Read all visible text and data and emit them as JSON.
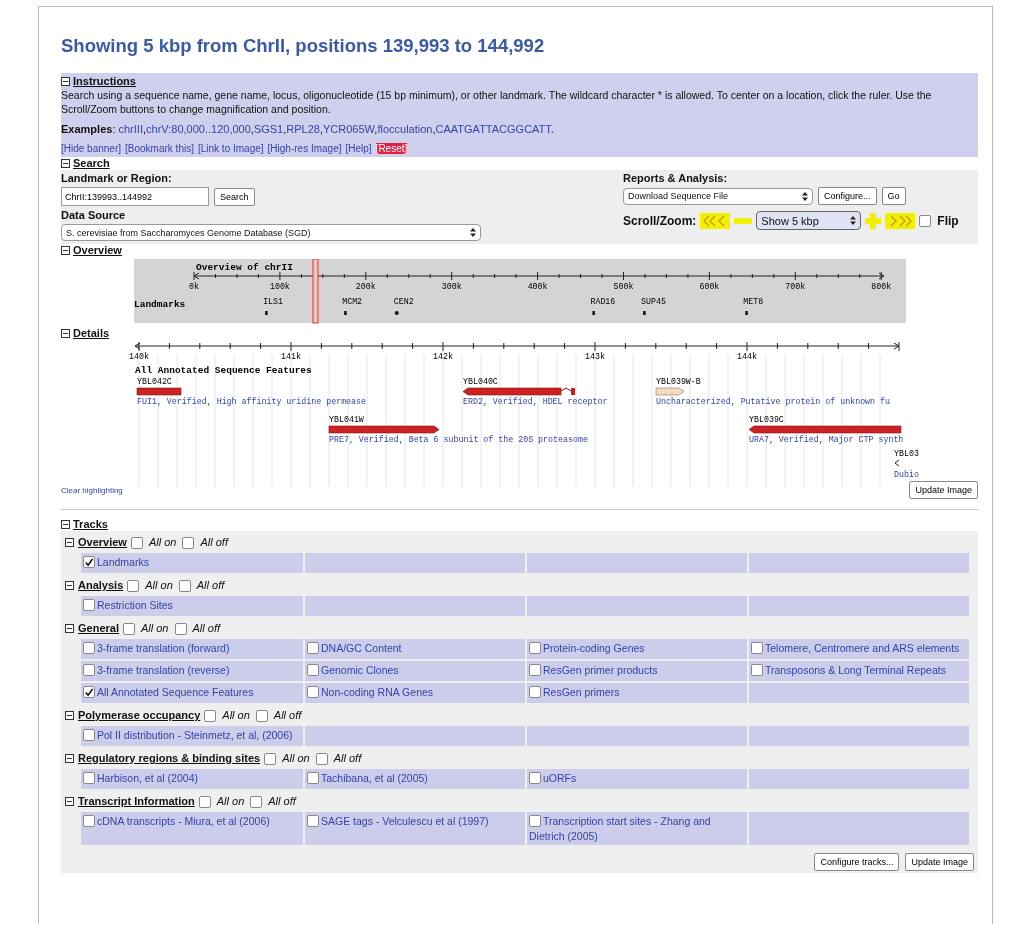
{
  "title": "Showing 5 kbp from ChrII, positions 139,993 to 144,992",
  "instructions": {
    "heading": "Instructions",
    "expanded": true,
    "text": "Search using a sequence name, gene name, locus, oligonucleotide (15 bp minimum), or other landmark. The wildcard character * is allowed. To center on a location, click the ruler. Use the Scroll/Zoom buttons to change magnification and position.",
    "examples_label": "**Examples**:",
    "examples": [
      {
        "label": "chrIII",
        "after": ","
      },
      {
        "label": "chrV:80,000..120,000",
        "after": ","
      },
      {
        "label": "SGS1",
        "after": ","
      },
      {
        "label": "RPL28",
        "after": ","
      },
      {
        "label": "YCR065W",
        "after": ","
      },
      {
        "label": "flocculation",
        "after": ","
      },
      {
        "label": "CAATGATTACGGCATT",
        "after": "."
      }
    ],
    "links": [
      {
        "label": "[Hide banner]",
        "highlighted": false
      },
      {
        "label": "[Bookmark this]",
        "highlighted": false
      },
      {
        "label": "[Link to Image]",
        "highlighted": false
      },
      {
        "label": "[High-res Image]",
        "highlighted": false
      },
      {
        "label": "[Help]",
        "highlighted": false
      },
      {
        "label": "[Reset]",
        "highlighted": true
      }
    ]
  },
  "search": {
    "heading": "Search",
    "expanded": true,
    "landmark_label": "Landmark or Region:",
    "landmark_value": "ChrII:139993..144992",
    "search_button": "Search",
    "data_source_label": "Data Source",
    "data_source_value": "S. cerevisiae from Saccharomyces Genome Database (SGD)",
    "reports_label": "Reports & Analysis:",
    "reports_value": "Download Sequence File",
    "configure_button": "Configure...",
    "go_button": "Go",
    "scroll_label": "Scroll/Zoom:",
    "zoom_value": "Show 5 kbp",
    "flip_label": "Flip",
    "flip_checked": false
  },
  "overview": {
    "heading": "Overview",
    "expanded": true,
    "title": "Overview of chrII",
    "ticks": [
      "0k",
      "100k",
      "200k",
      "300k",
      "400k",
      "500k",
      "600k",
      "700k",
      "800k"
    ],
    "landmarks_label": "Landmarks",
    "landmarks": [
      "ILS1",
      "MCM2",
      "CEN2",
      "RAD16",
      "SUP45",
      "MET8"
    ]
  },
  "details": {
    "heading": "Details",
    "expanded": true,
    "ticks": [
      "140k",
      "141k",
      "142k",
      "143k",
      "144k"
    ],
    "track_title": "All Annotated Sequence Features",
    "features": [
      {
        "id": "YBL042C",
        "description": "FUI1, Verified, High affinity uridine permease",
        "kind": "gene"
      },
      {
        "id": "YBL040C",
        "description": "ERD2, Verified, HDEL receptor",
        "kind": "gene"
      },
      {
        "id": "YBL039W-B",
        "description": "Uncharacterized, Putative protein of unknown fu",
        "kind": "uncharacterized"
      },
      {
        "id": "YBL041W",
        "description": "PRE7, Verified, Beta 6 subunit of the 20S proteasome",
        "kind": "gene"
      },
      {
        "id": "YBL039C",
        "description": "URA7, Verified, Major CTP synth",
        "kind": "gene"
      },
      {
        "id": "YBL03",
        "description": "Dubio",
        "kind": "small"
      }
    ],
    "clear_link": "Clear highlighting",
    "update_button": "Update Image"
  },
  "tracks": {
    "heading": "Tracks",
    "expanded": true,
    "groups": [
      {
        "name": "Overview",
        "expanded": true,
        "all_on": {
          "label": "All on",
          "checked": false
        },
        "all_off": {
          "label": "All off",
          "checked": false
        },
        "items": [
          {
            "label": "Landmarks",
            "checked": true
          }
        ]
      },
      {
        "name": "Analysis",
        "expanded": true,
        "all_on": {
          "label": "All on",
          "checked": false
        },
        "all_off": {
          "label": "All off",
          "checked": false
        },
        "items": [
          {
            "label": "Restriction Sites",
            "checked": false
          }
        ]
      },
      {
        "name": "General",
        "expanded": true,
        "all_on": {
          "label": "All on",
          "checked": false
        },
        "all_off": {
          "label": "All off",
          "checked": false
        },
        "items": [
          {
            "label": "3-frame translation (forward)",
            "checked": false
          },
          {
            "label": "DNA/GC Content",
            "checked": false
          },
          {
            "label": "Protein-coding Genes",
            "checked": false
          },
          {
            "label": "Telomere, Centromere and ARS elements",
            "checked": false
          },
          {
            "label": "3-frame translation (reverse)",
            "checked": false
          },
          {
            "label": "Genomic Clones",
            "checked": false
          },
          {
            "label": "ResGen primer products",
            "checked": false
          },
          {
            "label": "Transposons & Long Terminal Repeats",
            "checked": false
          },
          {
            "label": "All Annotated Sequence Features",
            "checked": true
          },
          {
            "label": "Non-coding RNA Genes",
            "checked": false
          },
          {
            "label": "ResGen primers",
            "checked": false
          }
        ]
      },
      {
        "name": "Polymerase occupancy",
        "expanded": true,
        "all_on": {
          "label": "All on",
          "checked": false
        },
        "all_off": {
          "label": "All off",
          "checked": false
        },
        "items": [
          {
            "label": "Pol II distribution - Steinmetz, et al, (2006)",
            "checked": false
          }
        ]
      },
      {
        "name": "Regulatory regions & binding sites",
        "expanded": true,
        "all_on": {
          "label": "All on",
          "checked": false
        },
        "all_off": {
          "label": "All off",
          "checked": false
        },
        "items": [
          {
            "label": "Harbison, et al (2004)",
            "checked": false
          },
          {
            "label": "Tachibana, et al (2005)",
            "checked": false
          },
          {
            "label": "uORFs",
            "checked": false
          }
        ]
      },
      {
        "name": "Transcript Information",
        "expanded": true,
        "all_on": {
          "label": "All on",
          "checked": false
        },
        "all_off": {
          "label": "All off",
          "checked": false
        },
        "items": [
          {
            "label": "cDNA transcripts - Miura, et al (2006)",
            "checked": false
          },
          {
            "label": "SAGE tags - Velculescu et al (1997)",
            "checked": false
          },
          {
            "label": "Transcription start sites - Zhang and Dietrich (2005)",
            "checked": false
          }
        ]
      }
    ],
    "configure_button": "Configure tracks...",
    "update_button": "Update Image"
  }
}
